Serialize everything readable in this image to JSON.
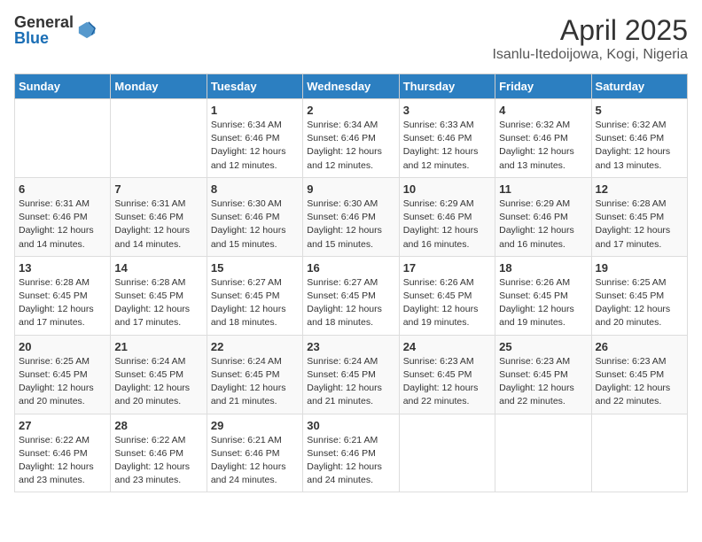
{
  "logo": {
    "general": "General",
    "blue": "Blue"
  },
  "title": "April 2025",
  "subtitle": "Isanlu-Itedoijowa, Kogi, Nigeria",
  "days_of_week": [
    "Sunday",
    "Monday",
    "Tuesday",
    "Wednesday",
    "Thursday",
    "Friday",
    "Saturday"
  ],
  "weeks": [
    [
      {
        "day": "",
        "info": ""
      },
      {
        "day": "",
        "info": ""
      },
      {
        "day": "1",
        "info": "Sunrise: 6:34 AM\nSunset: 6:46 PM\nDaylight: 12 hours and 12 minutes."
      },
      {
        "day": "2",
        "info": "Sunrise: 6:34 AM\nSunset: 6:46 PM\nDaylight: 12 hours and 12 minutes."
      },
      {
        "day": "3",
        "info": "Sunrise: 6:33 AM\nSunset: 6:46 PM\nDaylight: 12 hours and 12 minutes."
      },
      {
        "day": "4",
        "info": "Sunrise: 6:32 AM\nSunset: 6:46 PM\nDaylight: 12 hours and 13 minutes."
      },
      {
        "day": "5",
        "info": "Sunrise: 6:32 AM\nSunset: 6:46 PM\nDaylight: 12 hours and 13 minutes."
      }
    ],
    [
      {
        "day": "6",
        "info": "Sunrise: 6:31 AM\nSunset: 6:46 PM\nDaylight: 12 hours and 14 minutes."
      },
      {
        "day": "7",
        "info": "Sunrise: 6:31 AM\nSunset: 6:46 PM\nDaylight: 12 hours and 14 minutes."
      },
      {
        "day": "8",
        "info": "Sunrise: 6:30 AM\nSunset: 6:46 PM\nDaylight: 12 hours and 15 minutes."
      },
      {
        "day": "9",
        "info": "Sunrise: 6:30 AM\nSunset: 6:46 PM\nDaylight: 12 hours and 15 minutes."
      },
      {
        "day": "10",
        "info": "Sunrise: 6:29 AM\nSunset: 6:46 PM\nDaylight: 12 hours and 16 minutes."
      },
      {
        "day": "11",
        "info": "Sunrise: 6:29 AM\nSunset: 6:46 PM\nDaylight: 12 hours and 16 minutes."
      },
      {
        "day": "12",
        "info": "Sunrise: 6:28 AM\nSunset: 6:45 PM\nDaylight: 12 hours and 17 minutes."
      }
    ],
    [
      {
        "day": "13",
        "info": "Sunrise: 6:28 AM\nSunset: 6:45 PM\nDaylight: 12 hours and 17 minutes."
      },
      {
        "day": "14",
        "info": "Sunrise: 6:28 AM\nSunset: 6:45 PM\nDaylight: 12 hours and 17 minutes."
      },
      {
        "day": "15",
        "info": "Sunrise: 6:27 AM\nSunset: 6:45 PM\nDaylight: 12 hours and 18 minutes."
      },
      {
        "day": "16",
        "info": "Sunrise: 6:27 AM\nSunset: 6:45 PM\nDaylight: 12 hours and 18 minutes."
      },
      {
        "day": "17",
        "info": "Sunrise: 6:26 AM\nSunset: 6:45 PM\nDaylight: 12 hours and 19 minutes."
      },
      {
        "day": "18",
        "info": "Sunrise: 6:26 AM\nSunset: 6:45 PM\nDaylight: 12 hours and 19 minutes."
      },
      {
        "day": "19",
        "info": "Sunrise: 6:25 AM\nSunset: 6:45 PM\nDaylight: 12 hours and 20 minutes."
      }
    ],
    [
      {
        "day": "20",
        "info": "Sunrise: 6:25 AM\nSunset: 6:45 PM\nDaylight: 12 hours and 20 minutes."
      },
      {
        "day": "21",
        "info": "Sunrise: 6:24 AM\nSunset: 6:45 PM\nDaylight: 12 hours and 20 minutes."
      },
      {
        "day": "22",
        "info": "Sunrise: 6:24 AM\nSunset: 6:45 PM\nDaylight: 12 hours and 21 minutes."
      },
      {
        "day": "23",
        "info": "Sunrise: 6:24 AM\nSunset: 6:45 PM\nDaylight: 12 hours and 21 minutes."
      },
      {
        "day": "24",
        "info": "Sunrise: 6:23 AM\nSunset: 6:45 PM\nDaylight: 12 hours and 22 minutes."
      },
      {
        "day": "25",
        "info": "Sunrise: 6:23 AM\nSunset: 6:45 PM\nDaylight: 12 hours and 22 minutes."
      },
      {
        "day": "26",
        "info": "Sunrise: 6:23 AM\nSunset: 6:45 PM\nDaylight: 12 hours and 22 minutes."
      }
    ],
    [
      {
        "day": "27",
        "info": "Sunrise: 6:22 AM\nSunset: 6:46 PM\nDaylight: 12 hours and 23 minutes."
      },
      {
        "day": "28",
        "info": "Sunrise: 6:22 AM\nSunset: 6:46 PM\nDaylight: 12 hours and 23 minutes."
      },
      {
        "day": "29",
        "info": "Sunrise: 6:21 AM\nSunset: 6:46 PM\nDaylight: 12 hours and 24 minutes."
      },
      {
        "day": "30",
        "info": "Sunrise: 6:21 AM\nSunset: 6:46 PM\nDaylight: 12 hours and 24 minutes."
      },
      {
        "day": "",
        "info": ""
      },
      {
        "day": "",
        "info": ""
      },
      {
        "day": "",
        "info": ""
      }
    ]
  ]
}
